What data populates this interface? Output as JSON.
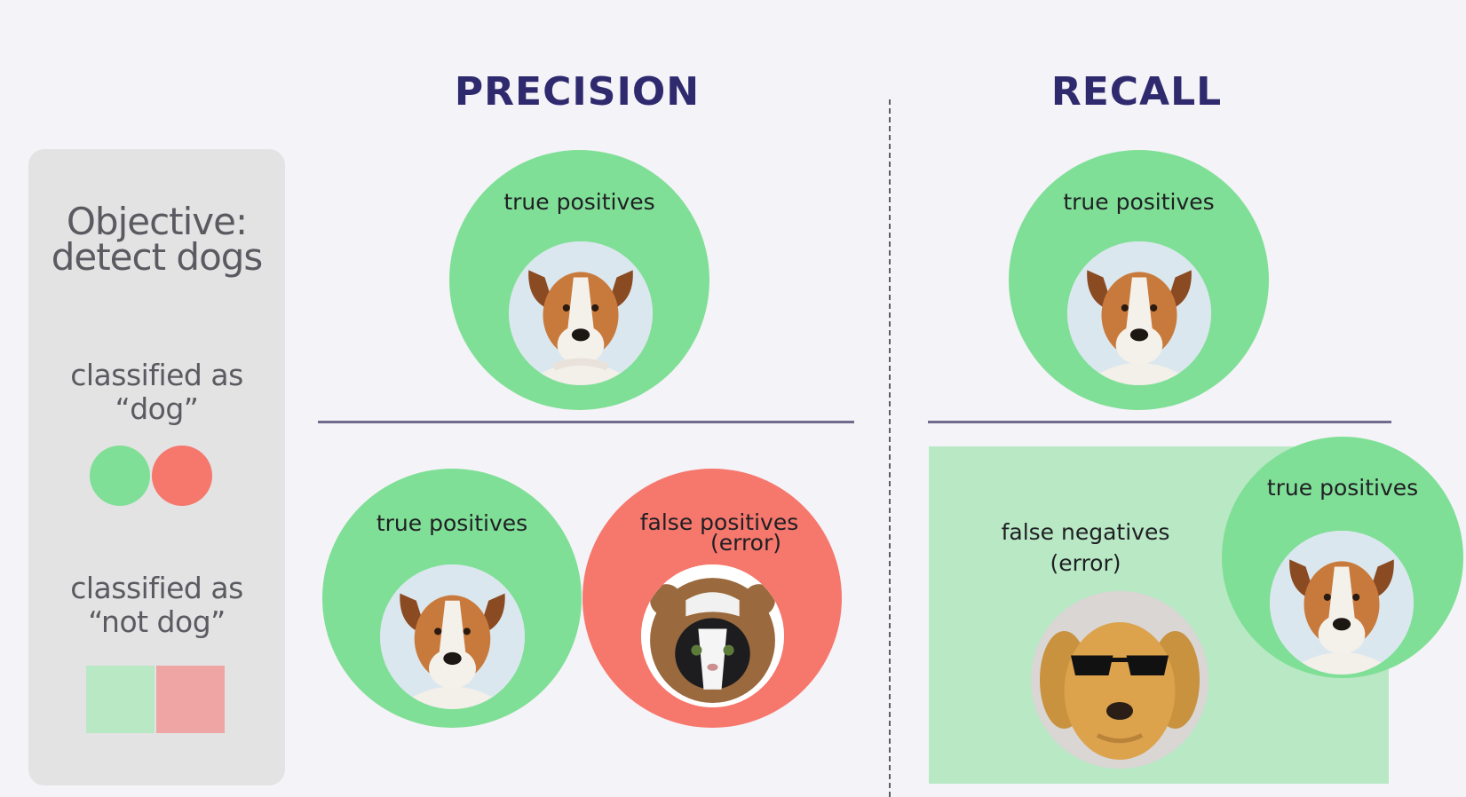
{
  "sidebar": {
    "objective_line1": "Objective:",
    "objective_line2": "detect dogs",
    "classified_dog_line1": "classified as",
    "classified_dog_line2": "“dog”",
    "classified_notdog_line1": "classified as",
    "classified_notdog_line2": "“not dog”"
  },
  "precision": {
    "heading": "PRECISION",
    "top_label": "true positives",
    "bottom_tp_label": "true positives",
    "bottom_fp_label_line1": "false positives",
    "bottom_fp_label_line2": "(error)"
  },
  "recall": {
    "heading": "RECALL",
    "top_label": "true positives",
    "bottom_tp_label": "true positives",
    "fn_label_line1": "false negatives",
    "fn_label_line2": "(error)"
  },
  "colors": {
    "green": "#80df96",
    "red": "#f6776c",
    "light_green": "#b8e8c4",
    "light_red": "#efa5a3",
    "heading": "#2f2a6e"
  }
}
